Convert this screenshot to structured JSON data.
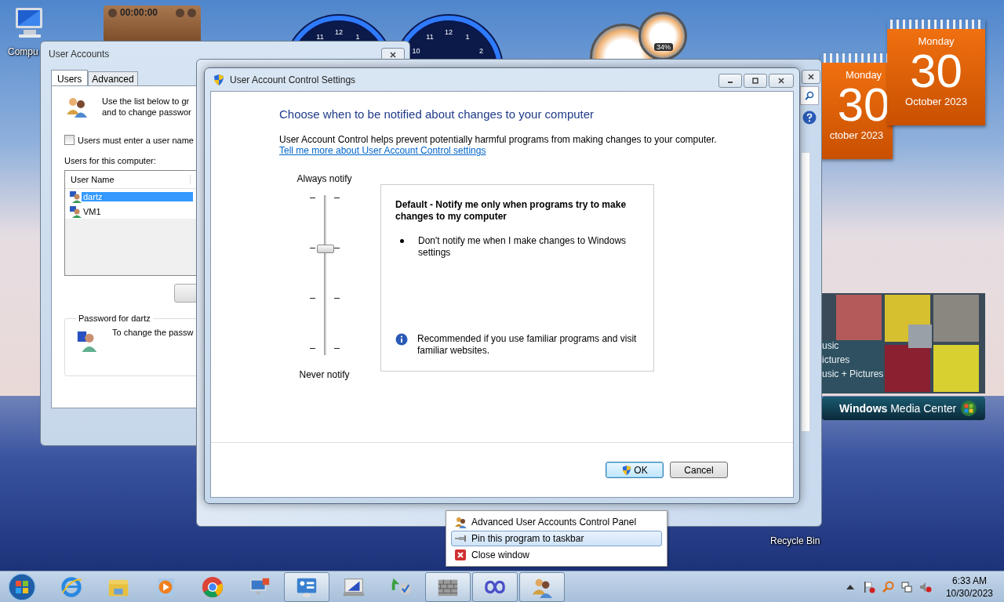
{
  "desktop": {
    "icons": [
      {
        "label": "Compu",
        "kind": "computer"
      },
      {
        "label": "Recycle Bin",
        "kind": "bin"
      }
    ]
  },
  "gadgets": {
    "timer": {
      "time": "00:00:00"
    },
    "clocks": [
      {
        "numerals": [
          "11",
          "12",
          "1"
        ]
      },
      {
        "numerals": [
          "10",
          "11",
          "12",
          "1",
          "2"
        ]
      }
    ],
    "meter": {
      "reading": "34%"
    },
    "calendars": [
      {
        "day": "Monday",
        "date": "30",
        "month": "ctober 2023"
      },
      {
        "day": "Monday",
        "date": "30",
        "month": "October 2023"
      }
    ],
    "media_center": {
      "menu": [
        "usic",
        "ictures",
        "usic + Pictures"
      ],
      "brand": "**Windows** Media Center"
    }
  },
  "user_accounts": {
    "title": "User Accounts",
    "tabs": [
      {
        "label": "Users",
        "selected": true
      },
      {
        "label": "Advanced",
        "selected": false
      }
    ],
    "intro": [
      "Use the list below to gr",
      "and to change passwor"
    ],
    "require_login": {
      "label": "Users must enter a user name",
      "checked": false
    },
    "list_label": "Users for this computer:",
    "table": {
      "columns": [
        "User Name"
      ],
      "rows": [
        {
          "name": "dartz",
          "selected": true
        },
        {
          "name": "VM1",
          "selected": false
        }
      ]
    },
    "password": {
      "title": "Password for dartz",
      "text": "To change the passw"
    }
  },
  "uac": {
    "title": "User Account Control Settings",
    "heading": "Choose when to be notified about changes to your computer",
    "description": "User Account Control helps prevent potentially harmful programs from making changes to your computer.",
    "link": "Tell me more about User Account Control settings",
    "slider": {
      "top_label": "Always notify",
      "bottom_label": "Never notify",
      "level": 0.667
    },
    "panel": {
      "title": "Default - Notify me only when programs try to make changes to my computer",
      "bullets": [
        "Don't notify me when I make changes to Windows settings"
      ],
      "note": "Recommended if you use familiar programs and visit familiar websites."
    },
    "buttons": [
      {
        "label": "OK",
        "default": true
      },
      {
        "label": "Cancel",
        "default": false
      }
    ]
  },
  "context_menu": [
    {
      "label": "Advanced User Accounts Control Panel",
      "kind": "users",
      "selected": false
    },
    {
      "label": "Pin this program to taskbar",
      "kind": "pin",
      "selected": true
    },
    {
      "label": "Close window",
      "kind": "close",
      "selected": false
    }
  ],
  "taskbar": {
    "buttons": [
      {
        "kind": "ie",
        "running": false
      },
      {
        "kind": "folder",
        "running": false
      },
      {
        "kind": "media",
        "running": false
      },
      {
        "kind": "chrome",
        "running": false
      },
      {
        "kind": "remote",
        "running": false
      },
      {
        "kind": "control",
        "running": true
      },
      {
        "kind": "monitor",
        "running": false
      },
      {
        "kind": "sync",
        "running": false
      },
      {
        "kind": "firewall",
        "running": true
      },
      {
        "kind": "infinity",
        "running": true
      },
      {
        "kind": "users",
        "running": true
      }
    ],
    "clock": {
      "time": "6:33 AM",
      "date": "10/30/2023"
    }
  }
}
